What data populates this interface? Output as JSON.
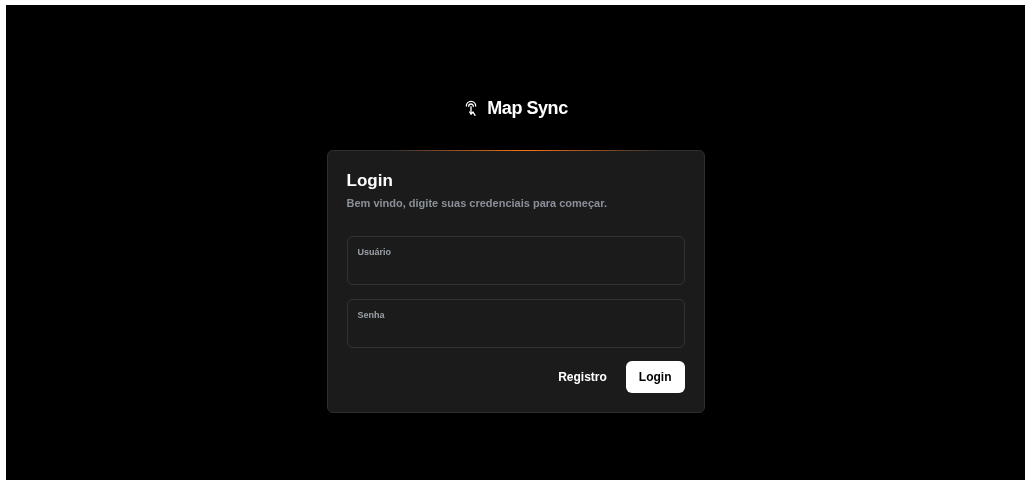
{
  "brand": {
    "name": "Map Sync"
  },
  "card": {
    "title": "Login",
    "subtitle": "Bem vindo, digite suas credenciais para começar.",
    "fields": [
      {
        "label": "Usuário"
      },
      {
        "label": "Senha"
      }
    ],
    "buttons": [
      {
        "label": "Registro",
        "kind": "ghost"
      },
      {
        "label": "Login",
        "kind": "primary"
      }
    ]
  }
}
